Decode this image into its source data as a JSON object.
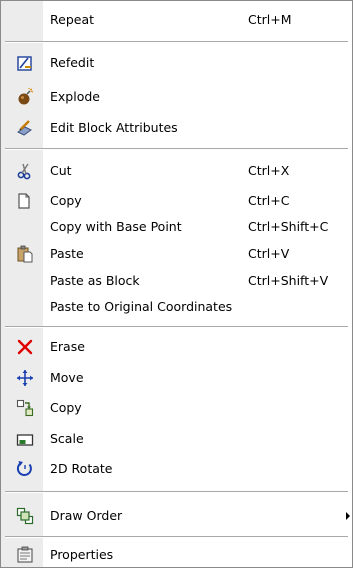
{
  "menu": {
    "repeat": {
      "label": "Repeat",
      "shortcut": "Ctrl+M"
    },
    "refedit": {
      "label": "Refedit"
    },
    "explode": {
      "label": "Explode"
    },
    "edit_block_attributes": {
      "label": "Edit Block Attributes"
    },
    "cut": {
      "label": "Cut",
      "shortcut": "Ctrl+X"
    },
    "copy_clip": {
      "label": "Copy",
      "shortcut": "Ctrl+C"
    },
    "copy_base_point": {
      "label": "Copy with Base Point",
      "shortcut": "Ctrl+Shift+C"
    },
    "paste": {
      "label": "Paste",
      "shortcut": "Ctrl+V"
    },
    "paste_as_block": {
      "label": "Paste as Block",
      "shortcut": "Ctrl+Shift+V"
    },
    "paste_original": {
      "label": "Paste to Original Coordinates"
    },
    "erase": {
      "label": "Erase"
    },
    "move": {
      "label": "Move"
    },
    "copy_object": {
      "label": "Copy"
    },
    "scale": {
      "label": "Scale"
    },
    "rotate_2d": {
      "label": "2D Rotate"
    },
    "draw_order": {
      "label": "Draw Order"
    },
    "properties": {
      "label": "Properties"
    }
  },
  "icons": {
    "refedit": "refedit-icon",
    "explode": "explode-icon",
    "edit_block_attributes": "edit-attributes-icon",
    "cut": "scissors-icon",
    "copy_clip": "copy-icon",
    "paste": "clipboard-icon",
    "erase": "erase-x-icon",
    "move": "move-arrows-icon",
    "copy_object": "copy-object-icon",
    "scale": "scale-icon",
    "rotate_2d": "rotate-icon",
    "draw_order": "draw-order-icon",
    "properties": "properties-icon"
  },
  "colors": {
    "gutter": "#ececec",
    "separator": "#a8a8a8",
    "erase_red": "#e00000",
    "move_blue": "#1a3fb0"
  }
}
